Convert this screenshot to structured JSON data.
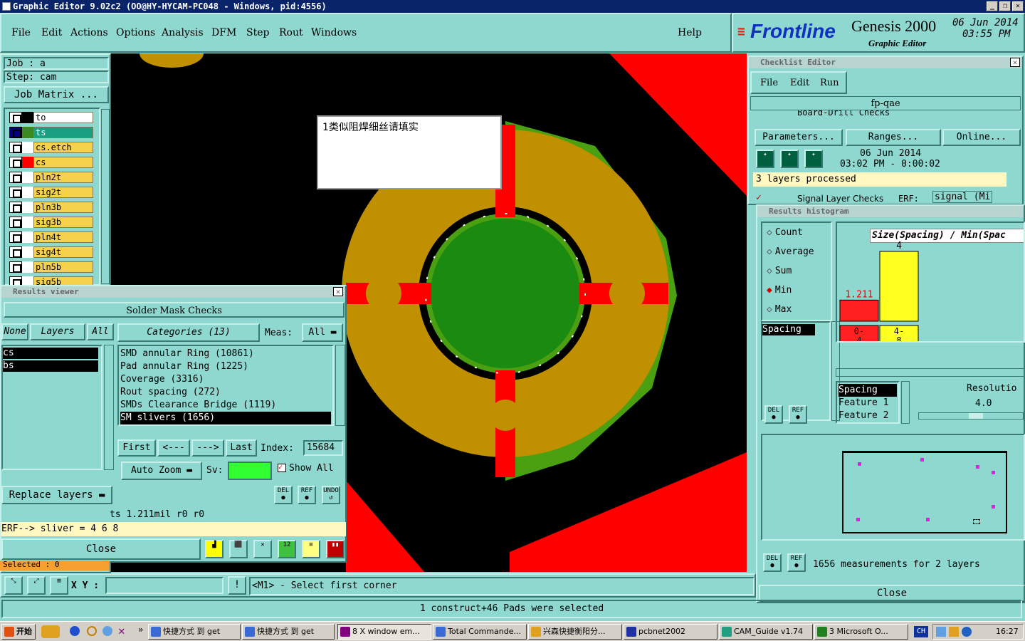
{
  "title": "Graphic Editor 9.02c2 (OO@HY-HYCAM-PC048 - Windows, pid:4556)",
  "menu": [
    "File",
    "Edit",
    "Actions",
    "Options",
    "Analysis",
    "DFM",
    "Step",
    "Rout",
    "Windows"
  ],
  "help": "Help",
  "logo": {
    "brand": "Frontline",
    "product": "Genesis 2000",
    "sub": "Graphic Editor",
    "date": "06 Jun 2014",
    "time": "03:55 PM"
  },
  "job": {
    "job": "Job : a",
    "step": "Step: cam",
    "matrix": "Job Matrix ..."
  },
  "layers": [
    {
      "name": "to",
      "color": "#ffffff"
    },
    {
      "name": "ts",
      "color": "#1aa080"
    },
    {
      "name": "cs.etch",
      "color": "#f6d24c"
    },
    {
      "name": "cs",
      "color": "#f6d24c"
    },
    {
      "name": "pln2t",
      "color": "#f6d24c"
    },
    {
      "name": "sig2t",
      "color": "#f6d24c"
    },
    {
      "name": "pln3b",
      "color": "#f6d24c"
    },
    {
      "name": "sig3b",
      "color": "#f6d24c"
    },
    {
      "name": "pln4t",
      "color": "#f6d24c"
    },
    {
      "name": "sig4t",
      "color": "#f6d24c"
    },
    {
      "name": "pln5b",
      "color": "#f6d24c"
    },
    {
      "name": "sig5b",
      "color": "#f6d24c"
    }
  ],
  "note": "1类似阻焊细丝请填实",
  "results_viewer": {
    "title": "Results viewer",
    "section": "Solder Mask Checks",
    "none": "None",
    "layers": "Layers",
    "all": "All",
    "left_list": [
      "cs",
      "bs"
    ],
    "categories": "Categories (13)",
    "meas_label": "Meas:",
    "meas_value": "All",
    "items": [
      "SMD annular Ring (10861)",
      "Pad annular Ring (1225)",
      "Coverage (3316)",
      "Rout spacing (272)",
      "SMDs Clearance Bridge (1119)",
      "SM slivers (1656)"
    ],
    "first": "First",
    "prev": "<---",
    "next": "--->",
    "last": "Last",
    "index_label": "Index:",
    "index_value": "15684",
    "auto_zoom": "Auto Zoom",
    "sv": "Sv:",
    "show_all": "Show All",
    "replace": "Replace layers",
    "del": "DEL",
    "ref": "REF",
    "undo": "UNDO",
    "status1": "ts 1.211mil  r0  r0",
    "status2": "ERF--> sliver = 4 6 8",
    "close": "Close"
  },
  "checklist": {
    "title": "Checklist Editor",
    "menu": [
      "File",
      "Edit",
      "Run"
    ],
    "name": "fp-qae",
    "partial": "Board-Drill Checks",
    "erf1": "ERF:",
    "params": "Parameters...",
    "ranges": "Ranges...",
    "online": "Online...",
    "date": "06 Jun 2014",
    "time": "03:02 PM - 0:00:02",
    "processed": "3 layers processed",
    "signal": "Signal Layer Checks",
    "erf2": "ERF:",
    "signal_val": "signal (Mi"
  },
  "histogram": {
    "title": "Results histogram",
    "modes": [
      "Count",
      "Average",
      "Sum",
      "Min",
      "Max"
    ],
    "selected": "Min",
    "list": [
      "Spacing"
    ],
    "chart_title": "Size(Spacing) / Min(Spac",
    "chart_data": {
      "type": "bar",
      "categories": [
        "0-4",
        "4-8"
      ],
      "values": [
        1.211,
        4
      ],
      "data_labels": [
        "1.211",
        "4"
      ],
      "colors": [
        "#ff2020",
        "#ffff20"
      ]
    },
    "list2": [
      "Spacing",
      "Feature 1",
      "Feature 2"
    ],
    "resolution_label": "Resolutio",
    "resolution": "4.0",
    "measurements": "1656 measurements for 2 layers",
    "close": "Close"
  },
  "bottom": {
    "xy": "X Y :",
    "prompt": "<M1> - Select first corner",
    "status": "1 construct+46 Pads were selected",
    "selected": "Selected : 0"
  },
  "taskbar": {
    "start": "开始",
    "items": [
      "快捷方式 到 get",
      "快捷方式 到 get",
      "8 X window em...",
      "Total Commande...",
      "兴森快捷衡阳分...",
      "pcbnet2002",
      "CAM_Guide v1.74",
      "3 Microsoft O..."
    ],
    "clock": "16:27",
    "lang": "CH"
  }
}
